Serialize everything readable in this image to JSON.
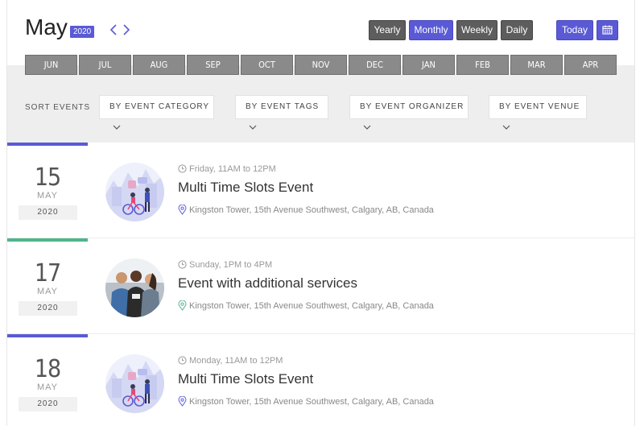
{
  "header": {
    "month": "May",
    "year_badge": "2020",
    "prev_icon": "chevron-left-icon",
    "next_icon": "chevron-right-icon"
  },
  "views": {
    "yearly": "Yearly",
    "monthly": "Monthly",
    "weekly": "Weekly",
    "daily": "Daily",
    "today": "Today",
    "calendar_icon": "calendar-icon"
  },
  "months": [
    "JUN",
    "JUL",
    "AUG",
    "SEP",
    "OCT",
    "NOV",
    "DEC",
    "JAN",
    "FEB",
    "MAR",
    "APR"
  ],
  "filters": {
    "sort_label": "SORT EVENTS",
    "category": "BY EVENT CATEGORY",
    "tags": "BY EVENT TAGS",
    "organizer": "BY EVENT ORGANIZER",
    "venue": "BY EVENT VENUE"
  },
  "colors": {
    "accent": "#5a5ad6",
    "green": "#4fb58a"
  },
  "events": [
    {
      "day": "15",
      "month": "MAY",
      "year": "2020",
      "time": "Friday, 11AM to 12PM",
      "title": "Multi Time Slots Event",
      "location": "Kingston Tower, 15th Avenue Southwest, Calgary, AB, Canada",
      "accent": "#5a5ad6"
    },
    {
      "day": "17",
      "month": "MAY",
      "year": "2020",
      "time": "Sunday, 1PM to 4PM",
      "title": "Event with additional services",
      "location": "Kingston Tower, 15th Avenue Southwest, Calgary, AB, Canada",
      "accent": "#4fb58a"
    },
    {
      "day": "18",
      "month": "MAY",
      "year": "2020",
      "time": "Monday, 11AM to 12PM",
      "title": "Multi Time Slots Event",
      "location": "Kingston Tower, 15th Avenue Southwest, Calgary, AB, Canada",
      "accent": "#5a5ad6"
    }
  ]
}
